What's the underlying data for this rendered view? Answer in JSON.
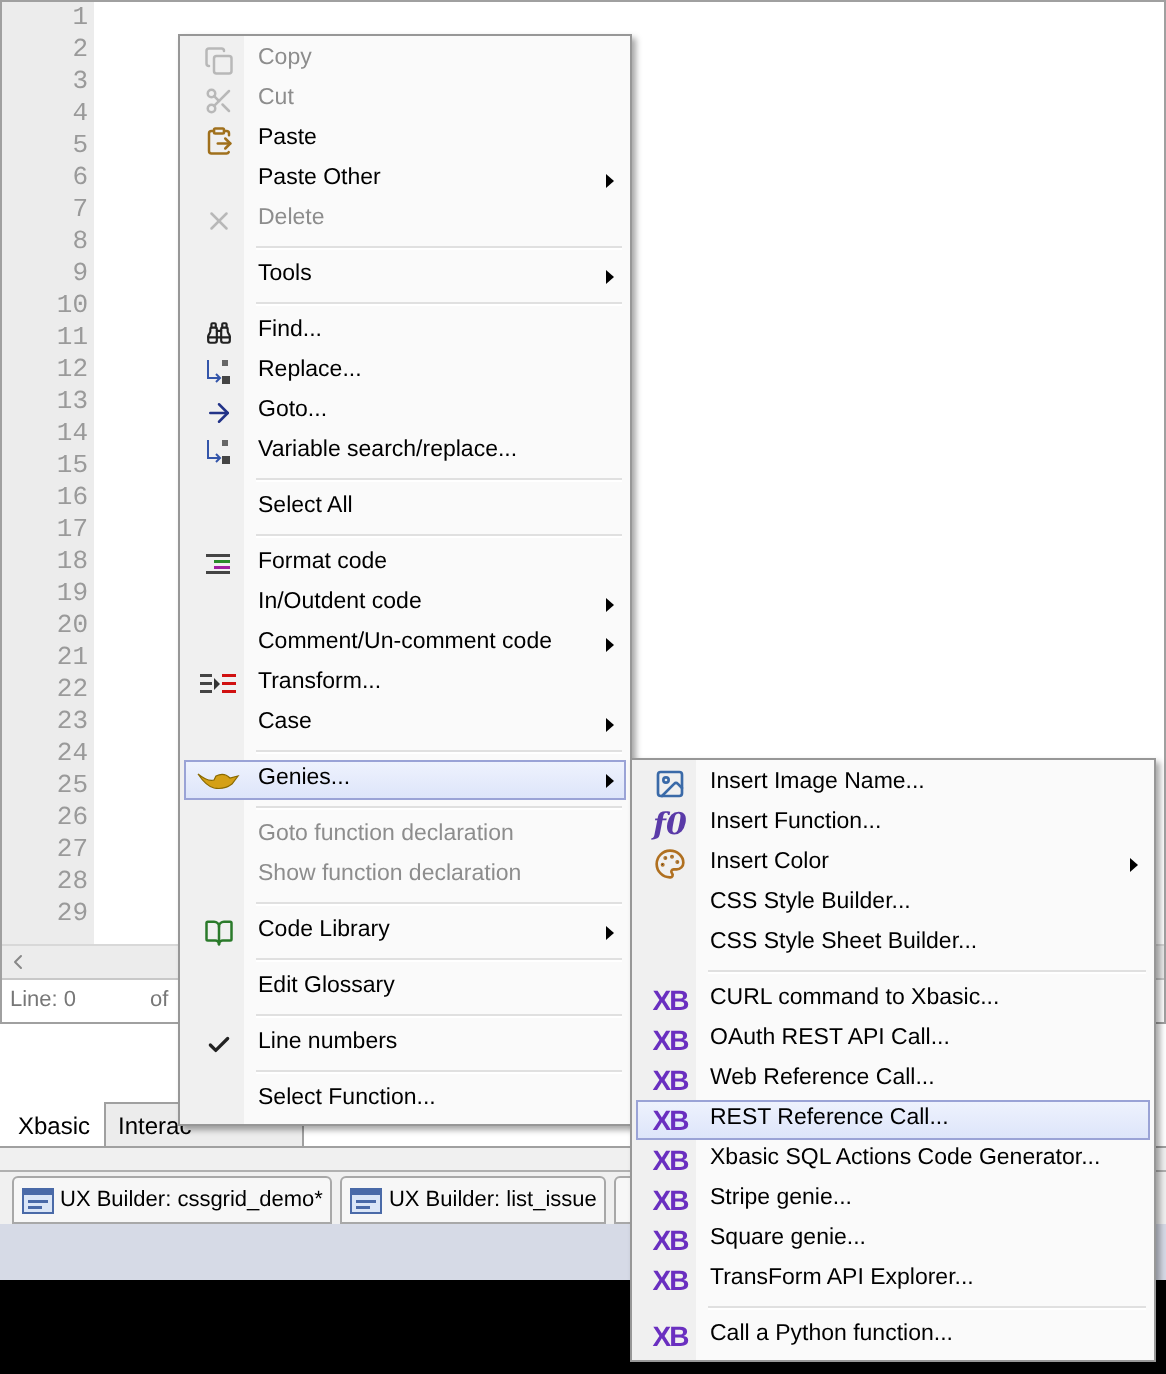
{
  "editor": {
    "line_numbers": [
      "1",
      "2",
      "3",
      "4",
      "5",
      "6",
      "7",
      "8",
      "9",
      "10",
      "11",
      "12",
      "13",
      "14",
      "15",
      "16",
      "17",
      "18",
      "19",
      "20",
      "21",
      "22",
      "23",
      "24",
      "25",
      "26",
      "27",
      "28",
      "29"
    ],
    "status": {
      "line": "Line: 0",
      "of": "of"
    }
  },
  "pane_tabs": [
    {
      "label": "Xbasic",
      "selected": true
    },
    {
      "label": "Interac",
      "selected": false
    }
  ],
  "document_tabs": [
    {
      "label": "UX Builder: cssgrid_demo*"
    },
    {
      "label": "UX Builder: list_issue"
    }
  ],
  "context_menu": {
    "items": [
      {
        "kind": "item",
        "label": "Copy",
        "disabled": true,
        "submenu": false,
        "selected": false,
        "checked": false
      },
      {
        "kind": "item",
        "label": "Cut",
        "disabled": true,
        "submenu": false,
        "selected": false,
        "checked": false
      },
      {
        "kind": "item",
        "label": "Paste",
        "disabled": false,
        "submenu": false,
        "selected": false,
        "checked": false
      },
      {
        "kind": "item",
        "label": "Paste Other",
        "disabled": false,
        "submenu": true,
        "selected": false,
        "checked": false
      },
      {
        "kind": "item",
        "label": "Delete",
        "disabled": true,
        "submenu": false,
        "selected": false,
        "checked": false
      },
      {
        "kind": "separator"
      },
      {
        "kind": "item",
        "label": "Tools",
        "disabled": false,
        "submenu": true,
        "selected": false,
        "checked": false
      },
      {
        "kind": "separator"
      },
      {
        "kind": "item",
        "label": "Find...",
        "disabled": false,
        "submenu": false,
        "selected": false,
        "checked": false
      },
      {
        "kind": "item",
        "label": "Replace...",
        "disabled": false,
        "submenu": false,
        "selected": false,
        "checked": false
      },
      {
        "kind": "item",
        "label": "Goto...",
        "disabled": false,
        "submenu": false,
        "selected": false,
        "checked": false
      },
      {
        "kind": "item",
        "label": "Variable search/replace...",
        "disabled": false,
        "submenu": false,
        "selected": false,
        "checked": false
      },
      {
        "kind": "separator"
      },
      {
        "kind": "item",
        "label": "Select All",
        "disabled": false,
        "submenu": false,
        "selected": false,
        "checked": false
      },
      {
        "kind": "separator"
      },
      {
        "kind": "item",
        "label": "Format code",
        "disabled": false,
        "submenu": false,
        "selected": false,
        "checked": false
      },
      {
        "kind": "item",
        "label": "In/Outdent code",
        "disabled": false,
        "submenu": true,
        "selected": false,
        "checked": false
      },
      {
        "kind": "item",
        "label": "Comment/Un-comment code",
        "disabled": false,
        "submenu": true,
        "selected": false,
        "checked": false
      },
      {
        "kind": "item",
        "label": "Transform...",
        "disabled": false,
        "submenu": false,
        "selected": false,
        "checked": false
      },
      {
        "kind": "item",
        "label": "Case",
        "disabled": false,
        "submenu": true,
        "selected": false,
        "checked": false
      },
      {
        "kind": "separator"
      },
      {
        "kind": "item",
        "label": "Genies...",
        "disabled": false,
        "submenu": true,
        "selected": true,
        "checked": false
      },
      {
        "kind": "separator"
      },
      {
        "kind": "item",
        "label": "Goto function declaration",
        "disabled": true,
        "submenu": false,
        "selected": false,
        "checked": false
      },
      {
        "kind": "item",
        "label": "Show function declaration",
        "disabled": true,
        "submenu": false,
        "selected": false,
        "checked": false
      },
      {
        "kind": "separator"
      },
      {
        "kind": "item",
        "label": "Code Library",
        "disabled": false,
        "submenu": true,
        "selected": false,
        "checked": false
      },
      {
        "kind": "separator"
      },
      {
        "kind": "item",
        "label": "Edit Glossary",
        "disabled": false,
        "submenu": false,
        "selected": false,
        "checked": false
      },
      {
        "kind": "separator"
      },
      {
        "kind": "item",
        "label": "Line numbers",
        "disabled": false,
        "submenu": false,
        "selected": false,
        "checked": true
      },
      {
        "kind": "separator"
      },
      {
        "kind": "item",
        "label": "Select Function...",
        "disabled": false,
        "submenu": false,
        "selected": false,
        "checked": false
      }
    ]
  },
  "genies_submenu": {
    "items": [
      {
        "kind": "item",
        "label": "Insert Image Name...",
        "submenu": false,
        "selected": false
      },
      {
        "kind": "item",
        "label": "Insert Function...",
        "icon_text": "f0",
        "submenu": false,
        "selected": false
      },
      {
        "kind": "item",
        "label": "Insert Color",
        "submenu": true,
        "selected": false
      },
      {
        "kind": "item",
        "label": "CSS Style Builder...",
        "submenu": false,
        "selected": false
      },
      {
        "kind": "item",
        "label": "CSS Style Sheet Builder...",
        "submenu": false,
        "selected": false
      },
      {
        "kind": "separator"
      },
      {
        "kind": "item",
        "label": "CURL command to Xbasic...",
        "icon_text": "XB",
        "submenu": false,
        "selected": false
      },
      {
        "kind": "item",
        "label": "OAuth REST API Call...",
        "icon_text": "XB",
        "submenu": false,
        "selected": false
      },
      {
        "kind": "item",
        "label": "Web Reference Call...",
        "icon_text": "XB",
        "submenu": false,
        "selected": false
      },
      {
        "kind": "item",
        "label": "REST Reference Call...",
        "icon_text": "XB",
        "submenu": false,
        "selected": true
      },
      {
        "kind": "item",
        "label": "Xbasic SQL Actions Code Generator...",
        "icon_text": "XB",
        "submenu": false,
        "selected": false
      },
      {
        "kind": "item",
        "label": "Stripe genie...",
        "icon_text": "XB",
        "submenu": false,
        "selected": false
      },
      {
        "kind": "item",
        "label": "Square genie...",
        "icon_text": "XB",
        "submenu": false,
        "selected": false
      },
      {
        "kind": "item",
        "label": "TransForm API Explorer...",
        "icon_text": "XB",
        "submenu": false,
        "selected": false
      },
      {
        "kind": "separator"
      },
      {
        "kind": "item",
        "label": "Call a Python function...",
        "icon_text": "XB",
        "submenu": false,
        "selected": false
      }
    ]
  }
}
